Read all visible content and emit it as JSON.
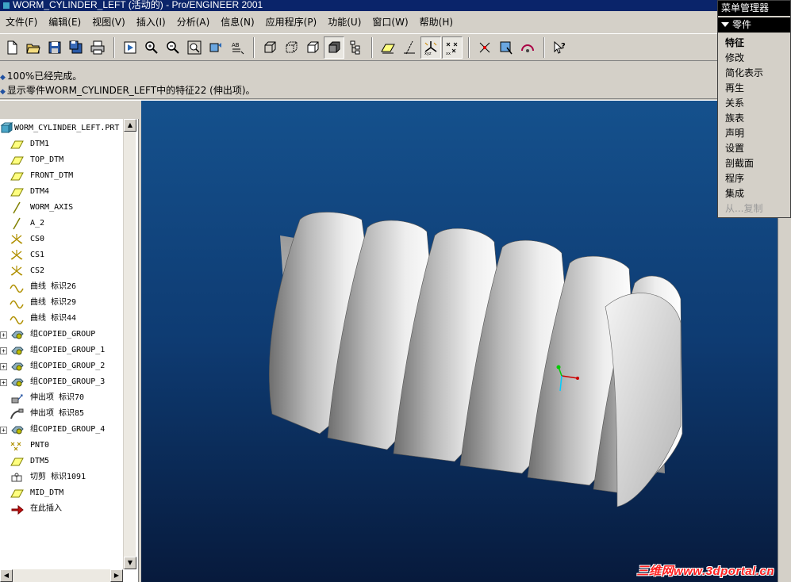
{
  "window": {
    "title": "WORM_CYLINDER_LEFT (活动的) - Pro/ENGINEER 2001"
  },
  "menubar": [
    {
      "label": "文件(F)"
    },
    {
      "label": "编辑(E)"
    },
    {
      "label": "视图(V)"
    },
    {
      "label": "插入(I)"
    },
    {
      "label": "分析(A)"
    },
    {
      "label": "信息(N)"
    },
    {
      "label": "应用程序(P)"
    },
    {
      "label": "功能(U)"
    },
    {
      "label": "窗口(W)"
    },
    {
      "label": "帮助(H)"
    }
  ],
  "toolbar": {
    "groups": [
      [
        "new-file-icon",
        "open-folder-icon",
        "save-icon",
        "save-copy-icon",
        "print-icon"
      ],
      [
        "repaint-icon",
        "zoom-in-icon",
        "zoom-out-icon",
        "refit-icon",
        "orient-icon",
        "saved-views-icon"
      ],
      [
        "wireframe-icon",
        "hidden-line-icon",
        "no-hidden-icon",
        "shading-icon",
        "model-tree-icon"
      ],
      [
        "datum-plane-icon",
        "datum-axis-icon",
        "coordinate-system-icon",
        "datum-point-icon"
      ],
      [
        "spin-center-icon",
        "select-filter-icon",
        "orient-mode-icon"
      ],
      [
        "context-help-icon"
      ]
    ]
  },
  "messages": [
    {
      "text": "100%已经完成。"
    },
    {
      "text": "显示零件WORM_CYLINDER_LEFT中的特征22 (伸出项)。"
    }
  ],
  "model_tree": {
    "root": "WORM_CYLINDER_LEFT.PRT",
    "items": [
      {
        "label": "DTM1",
        "icon": "datum-plane-icon",
        "expandable": false
      },
      {
        "label": "TOP_DTM",
        "icon": "datum-plane-icon",
        "expandable": false
      },
      {
        "label": "FRONT_DTM",
        "icon": "datum-plane-icon",
        "expandable": false
      },
      {
        "label": "DTM4",
        "icon": "datum-plane-icon",
        "expandable": false
      },
      {
        "label": "WORM_AXIS",
        "icon": "datum-axis-icon",
        "expandable": false
      },
      {
        "label": "A_2",
        "icon": "datum-axis-icon",
        "expandable": false
      },
      {
        "label": "CS0",
        "icon": "coordinate-system-icon",
        "expandable": false
      },
      {
        "label": "CS1",
        "icon": "coordinate-system-icon",
        "expandable": false
      },
      {
        "label": "CS2",
        "icon": "coordinate-system-icon",
        "expandable": false
      },
      {
        "label": "曲线 标识26",
        "icon": "curve-icon",
        "expandable": false
      },
      {
        "label": "曲线 标识29",
        "icon": "curve-icon",
        "expandable": false
      },
      {
        "label": "曲线 标识44",
        "icon": "curve-icon",
        "expandable": false
      },
      {
        "label": "组COPIED_GROUP",
        "icon": "group-icon",
        "expandable": true
      },
      {
        "label": "组COPIED_GROUP_1",
        "icon": "group-icon",
        "expandable": true
      },
      {
        "label": "组COPIED_GROUP_2",
        "icon": "group-icon",
        "expandable": true
      },
      {
        "label": "组COPIED_GROUP_3",
        "icon": "group-icon",
        "expandable": true
      },
      {
        "label": "伸出项 标识70",
        "icon": "protrusion-icon",
        "expandable": false
      },
      {
        "label": "伸出项 标识85",
        "icon": "sweep-protrusion-icon",
        "expandable": false
      },
      {
        "label": "组COPIED_GROUP_4",
        "icon": "group-icon",
        "expandable": true
      },
      {
        "label": "PNT0",
        "icon": "datum-point-icon",
        "expandable": false
      },
      {
        "label": "DTM5",
        "icon": "datum-plane-icon",
        "expandable": false
      },
      {
        "label": "切剪 标识1091",
        "icon": "cut-icon",
        "expandable": false
      },
      {
        "label": "MID_DTM",
        "icon": "datum-plane-icon",
        "expandable": false
      },
      {
        "label": "在此插入",
        "icon": "insert-here-arrow-icon",
        "expandable": false
      }
    ]
  },
  "menu_manager": {
    "title": "菜单管理器",
    "section": "零件",
    "items": [
      {
        "label": "特征",
        "state": "selected"
      },
      {
        "label": "修改",
        "state": "normal"
      },
      {
        "label": "简化表示",
        "state": "normal"
      },
      {
        "label": "再生",
        "state": "normal"
      },
      {
        "label": "关系",
        "state": "normal"
      },
      {
        "label": "族表",
        "state": "normal"
      },
      {
        "label": "声明",
        "state": "normal"
      },
      {
        "label": "设置",
        "state": "normal"
      },
      {
        "label": "剖截面",
        "state": "normal"
      },
      {
        "label": "程序",
        "state": "normal"
      },
      {
        "label": "集成",
        "state": "normal"
      },
      {
        "label": "从...复制",
        "state": "disabled"
      }
    ]
  },
  "viewport": {
    "watermark": "三维网www.3dportal.cn",
    "model": "worm-gear-shaded-model"
  },
  "colors": {
    "title_bar": "#0a246a",
    "viewport_top": "#15518d",
    "viewport_bottom": "#071a3c",
    "model": "#c8c8c8",
    "watermark": "#ff2020"
  }
}
